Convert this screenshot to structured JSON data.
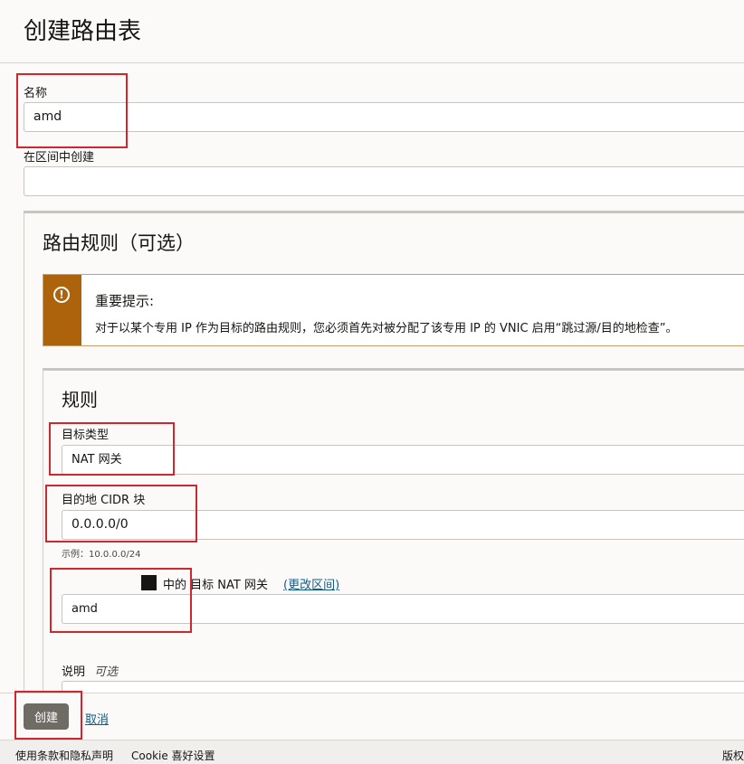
{
  "page": {
    "title": "创建路由表"
  },
  "form": {
    "name_label": "名称",
    "name_value": "amd",
    "compartment_label": "在区间中创建",
    "compartment_value": ""
  },
  "route_rules": {
    "title": "路由规则（可选）",
    "notice": {
      "icon": "exclamation-circle-icon",
      "title": "重要提示:",
      "body": "对于以某个专用 IP 作为目标的路由规则，您必须首先对被分配了该专用 IP 的 VNIC 启用“跳过源/目的地检查”。"
    },
    "rule": {
      "title": "规则",
      "target_type_label": "目标类型",
      "target_type_value": "NAT 网关",
      "dest_cidr_label": "目的地 CIDR 块",
      "dest_cidr_value": "0.0.0.0/0",
      "dest_cidr_hint": "示例：10.0.0.0/24",
      "target_nat_prefix": "中的 目标 NAT 网关",
      "change_compartment_link": "(更改区间)",
      "target_nat_value": "amd",
      "description_label": "说明",
      "description_optional": "可选"
    }
  },
  "actions": {
    "create_label": "创建",
    "cancel_label": "取消"
  },
  "bottom_bar": {
    "terms": "使用条款和隐私声明",
    "cookies": "Cookie 喜好设置",
    "copyright": "版权"
  },
  "colors": {
    "accent_button": "#6f6b65",
    "notice_bar": "#ac630c",
    "link": "#0e5d87",
    "highlight_box": "#d0272e"
  }
}
